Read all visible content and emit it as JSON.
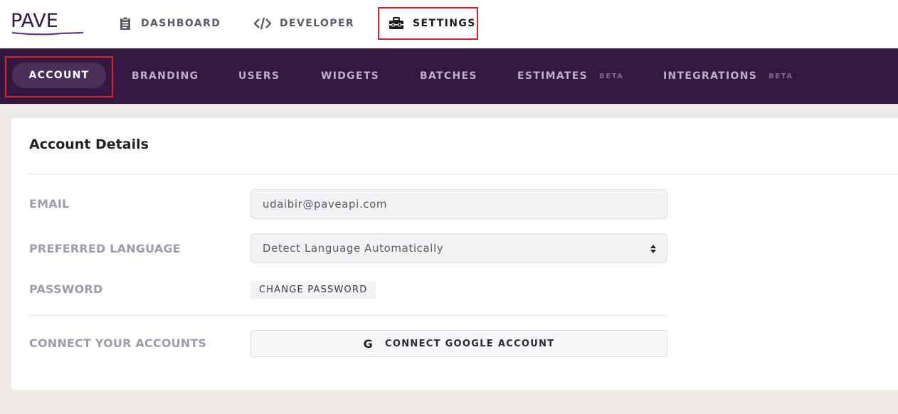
{
  "brand": {
    "logo_text": "PAVE",
    "primary": "#331840",
    "accent_outline": "#d8232a"
  },
  "topnav": {
    "items": [
      {
        "label": "DASHBOARD",
        "icon": "clipboard-icon"
      },
      {
        "label": "DEVELOPER",
        "icon": "code-icon"
      },
      {
        "label": "SETTINGS",
        "icon": "toolbox-icon",
        "active": true
      }
    ]
  },
  "subnav": {
    "items": [
      {
        "label": "ACCOUNT",
        "active": true
      },
      {
        "label": "BRANDING"
      },
      {
        "label": "USERS"
      },
      {
        "label": "WIDGETS"
      },
      {
        "label": "BATCHES"
      },
      {
        "label": "ESTIMATES",
        "badge": "BETA"
      },
      {
        "label": "INTEGRATIONS",
        "badge": "BETA"
      }
    ]
  },
  "account": {
    "title": "Account Details",
    "email_label": "EMAIL",
    "email_value": "udaibir@paveapi.com",
    "language_label": "PREFERRED LANGUAGE",
    "language_value": "Detect Language Automatically",
    "password_label": "PASSWORD",
    "change_password": "CHANGE PASSWORD",
    "connect_label": "CONNECT YOUR ACCOUNTS",
    "google_icon": "google-g-icon",
    "google_button": "CONNECT GOOGLE ACCOUNT"
  }
}
